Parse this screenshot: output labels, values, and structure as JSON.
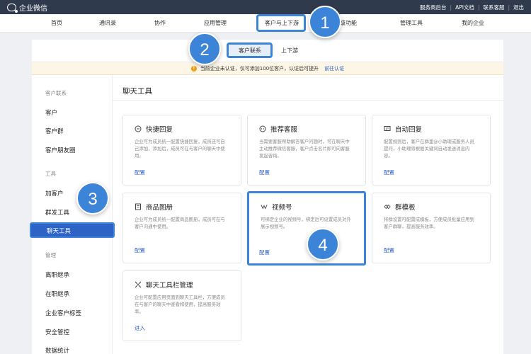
{
  "topbar": {
    "brand": "企业微信",
    "links": [
      "服务商后台",
      "API文档",
      "联系客服",
      "退出"
    ]
  },
  "mainnav": {
    "items": [
      "首页",
      "通讯录",
      "协作",
      "应用管理",
      "客户与上下游",
      "升级功能",
      "管理工具",
      "我的企业"
    ],
    "active": "客户与上下游"
  },
  "subtabs": {
    "active": "客户联系",
    "other": "上下游"
  },
  "notice": {
    "text": "当前企业未认证，仅可添加100位客户，认证后可提升",
    "link": "前往认证"
  },
  "sidebar": {
    "groups": [
      {
        "label": "客户联系",
        "items": [
          "客户",
          "客户群",
          "客户朋友圈"
        ]
      },
      {
        "label": "工具",
        "items": [
          "加客户",
          "群发工具",
          "聊天工具"
        ]
      },
      {
        "label": "管理",
        "items": [
          "离职继承",
          "在职继承",
          "企业客户标签",
          "安全管控",
          "数据统计"
        ]
      }
    ],
    "active": "聊天工具"
  },
  "main": {
    "title": "聊天工具",
    "cards": [
      {
        "title": "快捷回复",
        "icon": "quick-reply-icon",
        "desc": "企业可为成员统一配置快捷回复，成员还可自己添加，添加后，成员可在与客户的聊天中使用。",
        "action": "配置"
      },
      {
        "title": "推荐客服",
        "icon": "service-icon",
        "desc": "当需要客服帮助解答客户问题时，可在聊天中主动推荐微信客服，客户点击名片即可向客服发起咨询。",
        "action": "配置"
      },
      {
        "title": "自动回复",
        "icon": "auto-reply-icon",
        "desc": "配置规则后，客户在群里@小助理或服务人员提问，小助理将根据关键词自动发送消息内容。",
        "action": "配置"
      },
      {
        "title": "商品图册",
        "icon": "catalog-icon",
        "desc": "企业可为成员统一配置商品图册，成员可在与客户沟通中使用。",
        "action": "配置"
      },
      {
        "title": "视频号",
        "icon": "channels-icon",
        "desc": "可绑定企业的视频号，绑定后可设置成员对外展示视频号。",
        "action": "配置"
      },
      {
        "title": "群模板",
        "icon": "group-template-icon",
        "desc": "将群设置可配置成模板，方便成员批量应用到客户群聊，提高服务效率。",
        "action": "配置"
      },
      {
        "title": "聊天工具栏管理",
        "icon": "toolbar-icon",
        "desc": "企业可配置应用页面到聊天工具栏，方便成员在与客户的聊天中查看和使用，提高服务效率。",
        "action": "进入"
      }
    ]
  },
  "callouts": [
    "1",
    "2",
    "3",
    "4"
  ],
  "colors": {
    "accent": "#3c84d8",
    "topbar": "#2f3a4c",
    "link": "#2a62c9"
  }
}
